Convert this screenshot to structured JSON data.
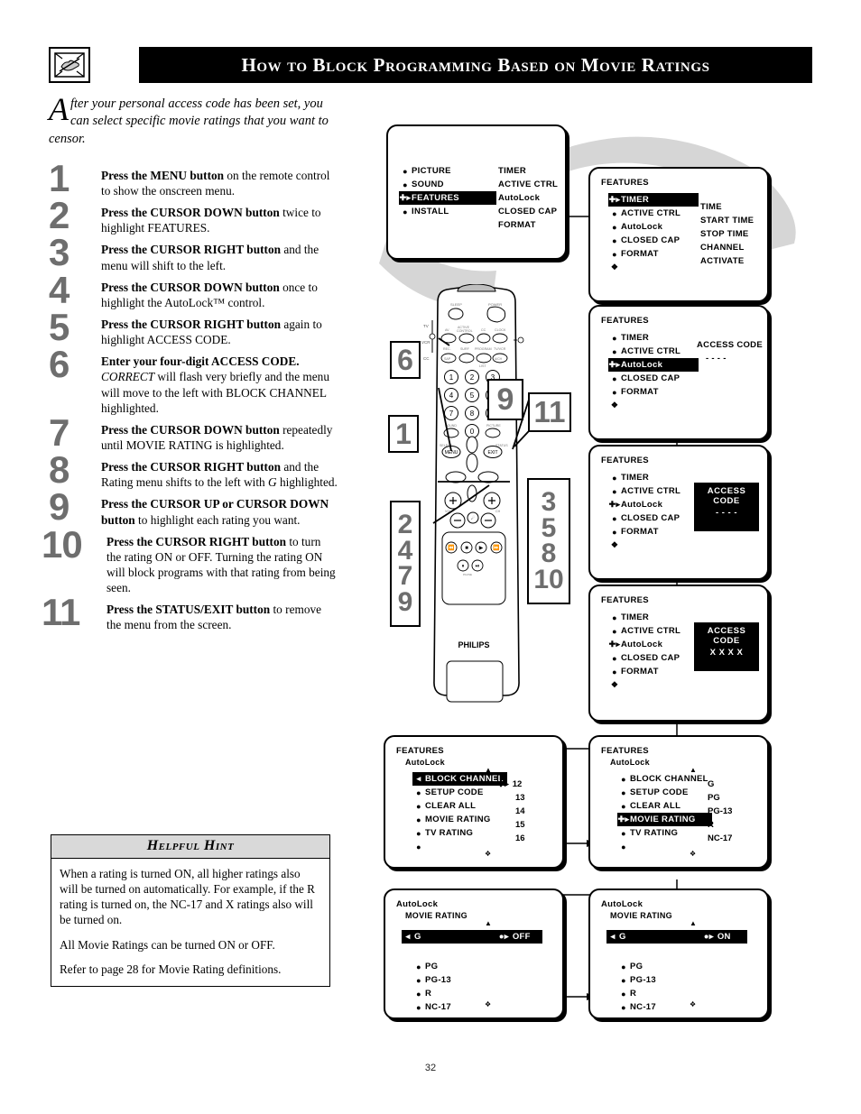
{
  "header": {
    "title": "How to Block Programming Based on Movie Ratings",
    "icon": "pointing-hand-tv-icon"
  },
  "intro": {
    "dropcap": "A",
    "text": "fter your personal access code has been set, you can select specific movie ratings that you want to censor."
  },
  "steps": [
    {
      "num": "1",
      "bold": "Press the MENU button",
      "rest": " on the remote control to show the onscreen menu."
    },
    {
      "num": "2",
      "bold": "Press the CURSOR DOWN button",
      "rest": " twice to highlight FEATURES."
    },
    {
      "num": "3",
      "bold": "Press the CURSOR RIGHT button",
      "rest": " and the menu will shift to the left."
    },
    {
      "num": "4",
      "bold": "Press the CURSOR DOWN button",
      "rest": " once to highlight the AutoLock™ control."
    },
    {
      "num": "5",
      "bold": "Press the CURSOR RIGHT button",
      "rest": " again to highlight ACCESS CODE."
    },
    {
      "num": "6",
      "bold": "Enter your four-digit ACCESS CODE.",
      "italic": "CORRECT",
      "rest": " will flash very briefly and the menu will move to the left with BLOCK CHANNEL highlighted."
    },
    {
      "num": "7",
      "bold": "Press the CURSOR DOWN button",
      "rest": " repeatedly until MOVIE RATING is highlighted."
    },
    {
      "num": "8",
      "bold": "Press the CURSOR RIGHT button",
      "rest": " and the Rating menu shifts to the left with ",
      "italic2": "G",
      "rest2": " highlighted."
    },
    {
      "num": "9",
      "bold": "Press the CURSOR UP or CURSOR DOWN button",
      "rest": " to highlight each rating you want."
    },
    {
      "num": "10",
      "bold": "Press the CURSOR RIGHT button",
      "rest": " to turn the rating ON or OFF.  Turning the rating ON will block programs with that rating from being seen."
    },
    {
      "num": "11",
      "bold": "Press the STATUS/EXIT button",
      "rest": " to remove the menu from the screen."
    }
  ],
  "hint": {
    "title": "Helpful Hint",
    "paragraphs": [
      "When a rating is turned ON, all higher ratings also will be turned on automatically.  For example, if the R rating is turned on, the NC-17 and X ratings also will be turned on.",
      "All Movie Ratings can be turned ON or OFF.",
      "Refer to page 28 for Movie Rating definitions."
    ]
  },
  "page_number": "32",
  "osd": {
    "main_menu": {
      "items": [
        "PICTURE",
        "SOUND",
        "FEATURES",
        "INSTALL"
      ],
      "highlighted": "FEATURES",
      "right_column": [
        "TIMER",
        "ACTIVE CTRL",
        "AutoLock",
        "CLOSED CAP",
        "FORMAT"
      ]
    },
    "features_timer": {
      "title": "FEATURES",
      "items": [
        "TIMER",
        "ACTIVE CTRL",
        "AutoLock",
        "CLOSED CAP",
        "FORMAT"
      ],
      "highlighted": "TIMER",
      "right_column": [
        "TIME",
        "START TIME",
        "STOP TIME",
        "CHANNEL",
        "ACTIVATE"
      ]
    },
    "features_autolock": {
      "title": "FEATURES",
      "items": [
        "TIMER",
        "ACTIVE CTRL",
        "AutoLock",
        "CLOSED CAP",
        "FORMAT"
      ],
      "highlighted": "AutoLock",
      "access_code_label": "ACCESS CODE",
      "access_code_value": "- - - -"
    },
    "features_access_empty": {
      "title": "FEATURES",
      "items": [
        "TIMER",
        "ACTIVE CTRL",
        "AutoLock",
        "CLOSED CAP",
        "FORMAT"
      ],
      "highlighted": "AutoLock",
      "access_code_label": "ACCESS CODE",
      "access_code_value": "- - - -"
    },
    "features_access_filled": {
      "title": "FEATURES",
      "items": [
        "TIMER",
        "ACTIVE CTRL",
        "AutoLock",
        "CLOSED CAP",
        "FORMAT"
      ],
      "highlighted": "AutoLock",
      "access_code_label": "ACCESS CODE",
      "access_code_value": "X X X X"
    },
    "autolock_block_channel": {
      "title": "FEATURES",
      "subtitle": "AutoLock",
      "items": [
        "BLOCK CHANNEL",
        "SETUP CODE",
        "CLEAR ALL",
        "MOVIE RATING",
        "TV RATING"
      ],
      "highlighted": "BLOCK CHANNEL",
      "values": [
        "12",
        "13",
        "14",
        "15",
        "16"
      ]
    },
    "autolock_movie_rating": {
      "title": "FEATURES",
      "subtitle": "AutoLock",
      "items": [
        "BLOCK CHANNEL",
        "SETUP CODE",
        "CLEAR ALL",
        "MOVIE RATING",
        "TV RATING"
      ],
      "highlighted": "MOVIE RATING",
      "values": [
        "G",
        "PG",
        "PG-13",
        "R",
        "NC-17"
      ]
    },
    "movie_rating_off": {
      "title": "AutoLock",
      "subtitle": "MOVIE RATING",
      "items": [
        "G",
        "PG",
        "PG-13",
        "R",
        "NC-17"
      ],
      "highlighted": "G",
      "state": "OFF"
    },
    "movie_rating_on": {
      "title": "AutoLock",
      "subtitle": "MOVIE RATING",
      "items": [
        "G",
        "PG",
        "PG-13",
        "R",
        "NC-17"
      ],
      "highlighted": "G",
      "state": "ON"
    }
  },
  "remote": {
    "brand": "PHILIPS",
    "buttons": {
      "sleep": "SLEEP",
      "power": "POWER",
      "av": "AV",
      "active_control": "ACTIVE CONTROL",
      "cc": "CC",
      "clock": "CLOCK",
      "rec_sap": "REC. SAP",
      "surf": "SURF",
      "program_list": "PROGRAM LIST",
      "tvvcr": "TV/VCR A/CH",
      "sound": "SOUND",
      "picture": "PICTURE",
      "select_menu": "MENU",
      "status_exit": "EXIT",
      "vol": "VOL",
      "ch": "CH",
      "mute": "MUTE"
    },
    "keypad": [
      "1",
      "2",
      "3",
      "4",
      "5",
      "6",
      "7",
      "8",
      "9",
      "0"
    ],
    "side_labels": [
      "TV",
      "VCR",
      "CC"
    ]
  },
  "callouts": {
    "six": "6",
    "nine": "9",
    "eleven": "11",
    "one": "1",
    "left_group": [
      "2",
      "4",
      "7",
      "9"
    ],
    "right_group": [
      "3",
      "5",
      "8",
      "10"
    ]
  }
}
